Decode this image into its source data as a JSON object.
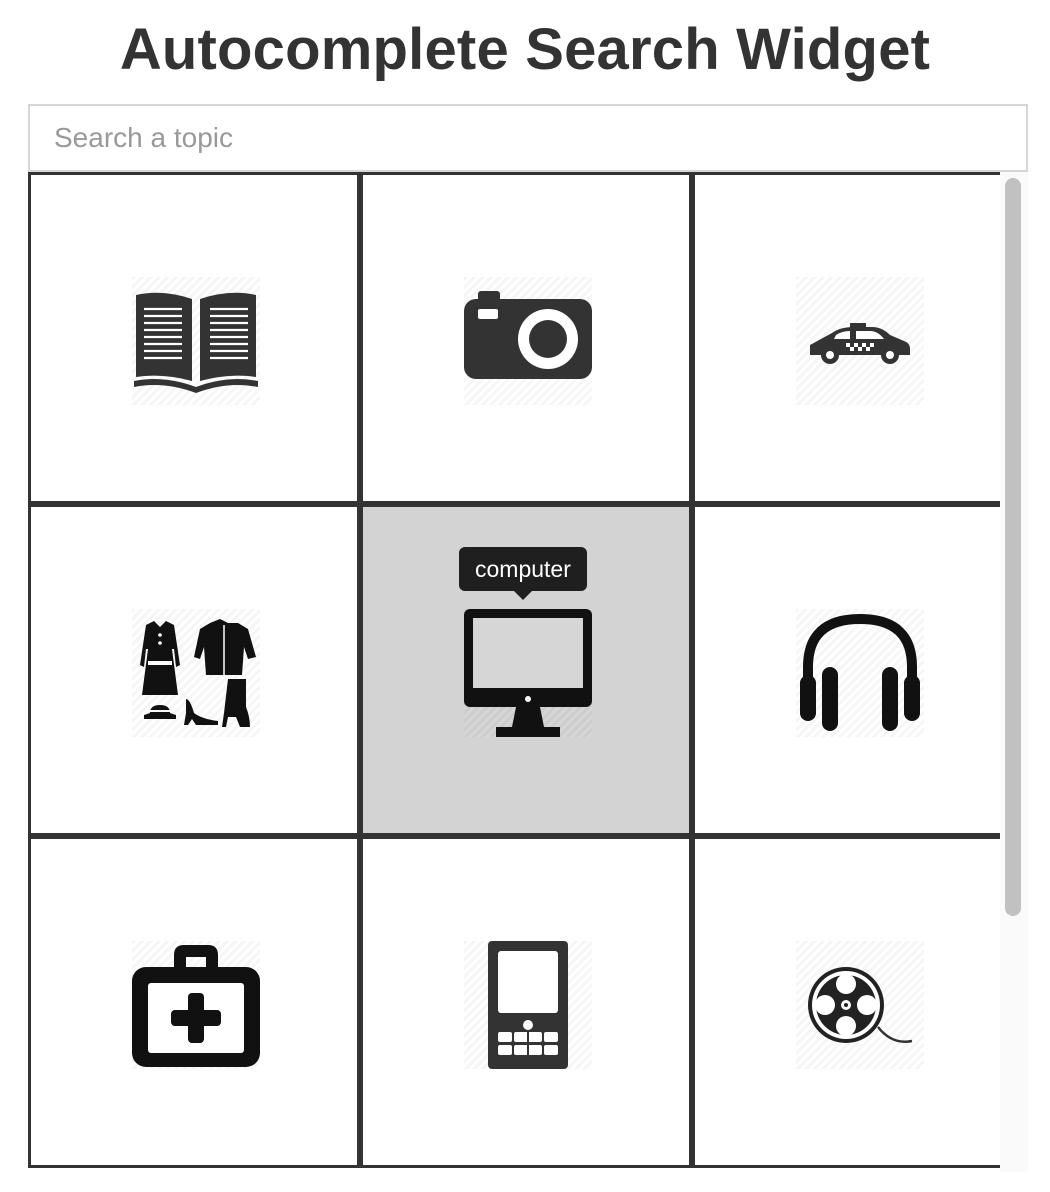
{
  "header": {
    "title": "Autocomplete Search Widget"
  },
  "search": {
    "placeholder": "Search a topic",
    "value": ""
  },
  "results": {
    "tiles": [
      {
        "icon": "book-icon",
        "label": ""
      },
      {
        "icon": "camera-icon",
        "label": ""
      },
      {
        "icon": "taxi-icon",
        "label": ""
      },
      {
        "icon": "clothing-icon",
        "label": ""
      },
      {
        "icon": "computer-icon",
        "label": "computer",
        "active": true
      },
      {
        "icon": "headphones-icon",
        "label": ""
      },
      {
        "icon": "medical-kit-icon",
        "label": ""
      },
      {
        "icon": "mobile-phone-icon",
        "label": ""
      },
      {
        "icon": "film-reel-icon",
        "label": ""
      }
    ],
    "tooltip": "computer"
  },
  "colors": {
    "title": "#333333",
    "tile_border": "#333333",
    "active_tile": "#d3d3d3",
    "tooltip_bg": "#1f1f1f",
    "placeholder": "#999999"
  }
}
